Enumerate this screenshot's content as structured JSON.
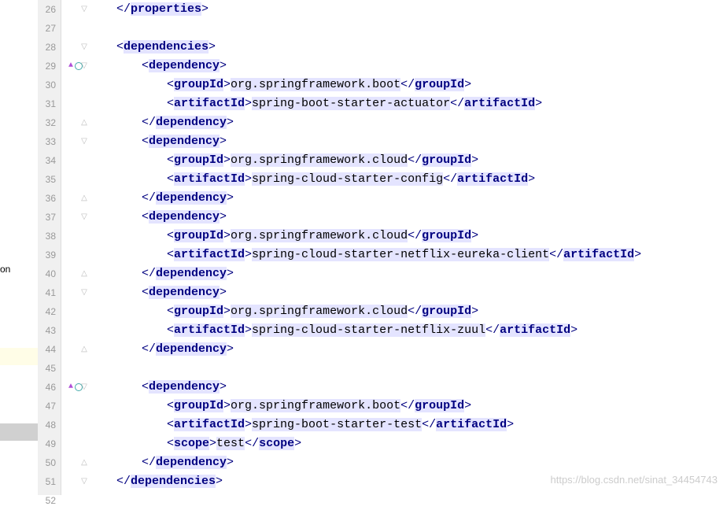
{
  "left_strip": {
    "text_fragment": "on"
  },
  "watermark": "https://blog.csdn.net/sinat_34454743",
  "gutter_lines": [
    "26",
    "27",
    "28",
    "29",
    "30",
    "31",
    "32",
    "33",
    "34",
    "35",
    "36",
    "37",
    "38",
    "39",
    "40",
    "41",
    "42",
    "43",
    "44",
    "45",
    "46",
    "47",
    "48",
    "49",
    "50",
    "51",
    "52"
  ],
  "markers": {
    "vcs_up_rows": [
      29,
      46
    ],
    "fold_close_rows": [
      26,
      51
    ],
    "fold_open_rows": [
      28,
      29,
      33,
      37,
      41,
      46
    ],
    "fold_end_rows": [
      32,
      36,
      40,
      44,
      50
    ]
  },
  "colors": {
    "tag_bg": "#e4e4ff",
    "tag_fg": "#000080"
  },
  "code": [
    {
      "indent": 0,
      "parts": [
        {
          "t": "close",
          "tag": "properties"
        }
      ]
    },
    {
      "indent": 0,
      "parts": []
    },
    {
      "indent": 0,
      "parts": [
        {
          "t": "open",
          "tag": "dependencies"
        }
      ]
    },
    {
      "indent": 1,
      "parts": [
        {
          "t": "open",
          "tag": "dependency"
        }
      ]
    },
    {
      "indent": 2,
      "parts": [
        {
          "t": "open",
          "tag": "groupId"
        },
        {
          "t": "txt",
          "v": "org.springframework.boot"
        },
        {
          "t": "close",
          "tag": "groupId"
        }
      ]
    },
    {
      "indent": 2,
      "parts": [
        {
          "t": "open",
          "tag": "artifactId"
        },
        {
          "t": "txt",
          "v": "spring-boot-starter-actuator"
        },
        {
          "t": "close",
          "tag": "artifactId"
        }
      ]
    },
    {
      "indent": 1,
      "parts": [
        {
          "t": "close",
          "tag": "dependency"
        }
      ]
    },
    {
      "indent": 1,
      "parts": [
        {
          "t": "open",
          "tag": "dependency"
        }
      ]
    },
    {
      "indent": 2,
      "parts": [
        {
          "t": "open",
          "tag": "groupId"
        },
        {
          "t": "txt",
          "v": "org.springframework.cloud"
        },
        {
          "t": "close",
          "tag": "groupId"
        }
      ]
    },
    {
      "indent": 2,
      "parts": [
        {
          "t": "open",
          "tag": "artifactId"
        },
        {
          "t": "txt",
          "v": "spring-cloud-starter-config"
        },
        {
          "t": "close",
          "tag": "artifactId"
        }
      ]
    },
    {
      "indent": 1,
      "parts": [
        {
          "t": "close",
          "tag": "dependency"
        }
      ]
    },
    {
      "indent": 1,
      "parts": [
        {
          "t": "open",
          "tag": "dependency"
        }
      ]
    },
    {
      "indent": 2,
      "parts": [
        {
          "t": "open",
          "tag": "groupId"
        },
        {
          "t": "txt",
          "v": "org.springframework.cloud"
        },
        {
          "t": "close",
          "tag": "groupId"
        }
      ]
    },
    {
      "indent": 2,
      "parts": [
        {
          "t": "open",
          "tag": "artifactId"
        },
        {
          "t": "txt",
          "v": "spring-cloud-starter-netflix-eureka-client"
        },
        {
          "t": "close",
          "tag": "artifactId"
        }
      ]
    },
    {
      "indent": 1,
      "parts": [
        {
          "t": "close",
          "tag": "dependency"
        }
      ]
    },
    {
      "indent": 1,
      "parts": [
        {
          "t": "open",
          "tag": "dependency"
        }
      ]
    },
    {
      "indent": 2,
      "parts": [
        {
          "t": "open",
          "tag": "groupId"
        },
        {
          "t": "txt",
          "v": "org.springframework.cloud"
        },
        {
          "t": "close",
          "tag": "groupId"
        }
      ]
    },
    {
      "indent": 2,
      "parts": [
        {
          "t": "open",
          "tag": "artifactId"
        },
        {
          "t": "txt",
          "v": "spring-cloud-starter-netflix-zuul"
        },
        {
          "t": "close",
          "tag": "artifactId"
        }
      ]
    },
    {
      "indent": 1,
      "parts": [
        {
          "t": "close",
          "tag": "dependency"
        }
      ]
    },
    {
      "indent": 0,
      "parts": []
    },
    {
      "indent": 1,
      "parts": [
        {
          "t": "open",
          "tag": "dependency"
        }
      ]
    },
    {
      "indent": 2,
      "parts": [
        {
          "t": "open",
          "tag": "groupId"
        },
        {
          "t": "txt",
          "v": "org.springframework.boot"
        },
        {
          "t": "close",
          "tag": "groupId"
        }
      ]
    },
    {
      "indent": 2,
      "parts": [
        {
          "t": "open",
          "tag": "artifactId"
        },
        {
          "t": "txt",
          "v": "spring-boot-starter-test"
        },
        {
          "t": "close",
          "tag": "artifactId"
        }
      ]
    },
    {
      "indent": 2,
      "parts": [
        {
          "t": "open",
          "tag": "scope"
        },
        {
          "t": "txt",
          "v": "test"
        },
        {
          "t": "close",
          "tag": "scope"
        }
      ]
    },
    {
      "indent": 1,
      "parts": [
        {
          "t": "close",
          "tag": "dependency"
        }
      ]
    },
    {
      "indent": 0,
      "parts": [
        {
          "t": "close",
          "tag": "dependencies"
        }
      ]
    },
    {
      "indent": 0,
      "parts": []
    }
  ]
}
